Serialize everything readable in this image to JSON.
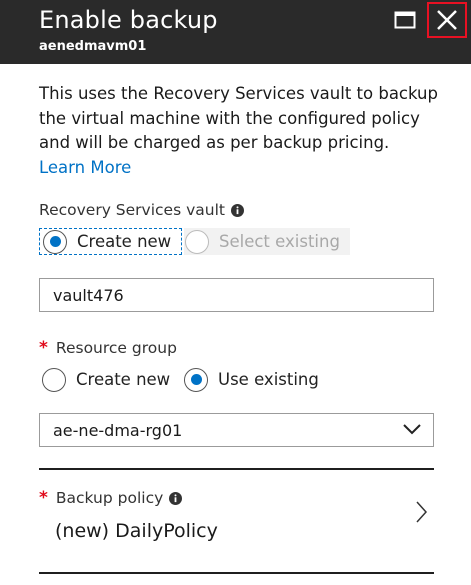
{
  "header": {
    "title": "Enable backup",
    "subtitle": "aenedmavm01",
    "maximize_icon": "maximize-icon",
    "close_icon": "close-icon"
  },
  "description": {
    "text": "This uses the Recovery Services vault to backup the virtual machine with the configured policy and will be charged as per backup pricing.",
    "link_label": "Learn More"
  },
  "vault": {
    "label": "Recovery Services vault",
    "options": [
      {
        "label": "Create new",
        "selected": true
      },
      {
        "label": "Select existing",
        "selected": false,
        "disabled": true
      }
    ],
    "name_value": "vault476"
  },
  "resource_group": {
    "label": "Resource group",
    "required_marker": "*",
    "options": [
      {
        "label": "Create new",
        "selected": false
      },
      {
        "label": "Use existing",
        "selected": true
      }
    ],
    "selected_value": "ae-ne-dma-rg01"
  },
  "backup_policy": {
    "label": "Backup policy",
    "required_marker": "*",
    "value": "(new) DailyPolicy"
  },
  "colors": {
    "header_bg": "#2a2a2a",
    "accent": "#0072c6",
    "close_highlight": "#e81123",
    "required": "#e00b1c"
  }
}
